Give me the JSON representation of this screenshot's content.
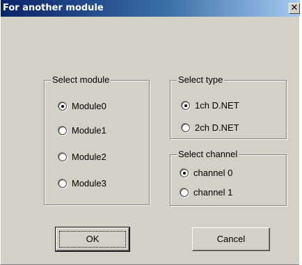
{
  "window": {
    "title": "For another module",
    "close_glyph": "✕"
  },
  "groups": {
    "module": {
      "title": "Select module",
      "options": [
        "Module0",
        "Module1",
        "Module2",
        "Module3"
      ],
      "selected": 0
    },
    "type": {
      "title": "Select type",
      "options": [
        "1ch D.NET",
        "2ch D.NET"
      ],
      "selected": 0
    },
    "channel": {
      "title": "Select channel",
      "options": [
        "channel 0",
        "channel 1"
      ],
      "selected": 0
    }
  },
  "buttons": {
    "ok": "OK",
    "cancel": "Cancel"
  }
}
